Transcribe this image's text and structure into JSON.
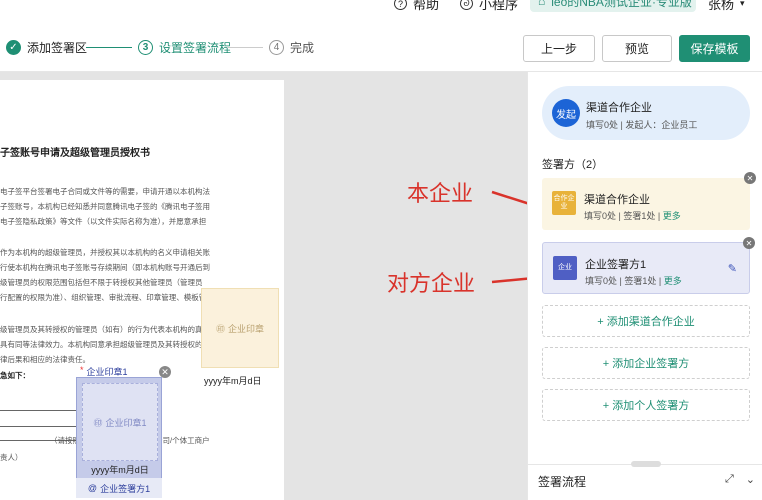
{
  "topbar": {
    "help": "帮助",
    "miniprogram": "小程序",
    "team": "leo的NBA测试企业·专业版",
    "user": "张杨"
  },
  "steps": [
    {
      "num": "✓",
      "label": "添加签署区"
    },
    {
      "num": "3",
      "label": "设置签署流程"
    },
    {
      "num": "4",
      "label": "完成"
    }
  ],
  "buttons": {
    "prev": "上一步",
    "preview": "预览",
    "save_template": "保存模板"
  },
  "document": {
    "title": "子签账号申请及超级管理员授权书",
    "lines": [
      "电子签平台签署电子合同或文件等的需要，申请开通以本机构法",
      "子签账号，本机构已经知悉并同意腾讯电子签的《腾讯电子签用",
      "电子签隐私政策》等文件（以文件实际名称为准），并愿意承担",
      "作为本机构的超级管理员，并授权其以本机构的名义申请相关账",
      "行使本机构在腾讯电子签账号存续期间（即本机构账号开通后到",
      "级管理员的权限范围包括但不限于转授权其他管理员（管理员",
      "行配置的权限为准）、组织管理、审批流程、印章管理、模板管",
      "级管理员及其转授权的管理员（如有）的行为代表本机构的真实",
      "具有同等法律效力。本机构同意承担超级管理员及其转授权的管",
      "律后果和相应的法律责任。",
      "急如下："
    ],
    "note": "（请按照机构证件如实填写：分公司/个体工商户",
    "note2": "责人）"
  },
  "seals": {
    "right_label": "企业印章",
    "right_date": "yyyy年m月d日",
    "left_head": "企业印章1",
    "left_inner": "企业印章1",
    "left_date": "yyyy年m月d日",
    "left_foot": "企业签署方1",
    "required_mark": "*"
  },
  "annotations": {
    "self": "本企业",
    "counterparty": "对方企业"
  },
  "panel": {
    "initiator": {
      "badge": "发起",
      "name": "渠道合作企业",
      "sub": "填写0处 | 发起人：企业员工"
    },
    "signers_title": "签署方（2）",
    "cards": [
      {
        "icon": "合作企业",
        "name": "渠道合作企业",
        "sub": "填写0处 | 签署1处 | ",
        "more": "更多"
      },
      {
        "icon": "企业",
        "name": "企业签署方1",
        "sub": "填写0处 | 签署1处 | ",
        "more": "更多"
      }
    ],
    "add_buttons": [
      "+ 添加渠道合作企业",
      "+ 添加企业签署方",
      "+ 添加个人签署方"
    ],
    "flow_title": "签署流程"
  },
  "colors": {
    "brand": "#1f8f74",
    "annotation": "#d9332b",
    "initiator_bg": "#e3eefb",
    "self_card_bg": "#fbf5e3",
    "counter_card_bg": "#e8eaf7"
  }
}
